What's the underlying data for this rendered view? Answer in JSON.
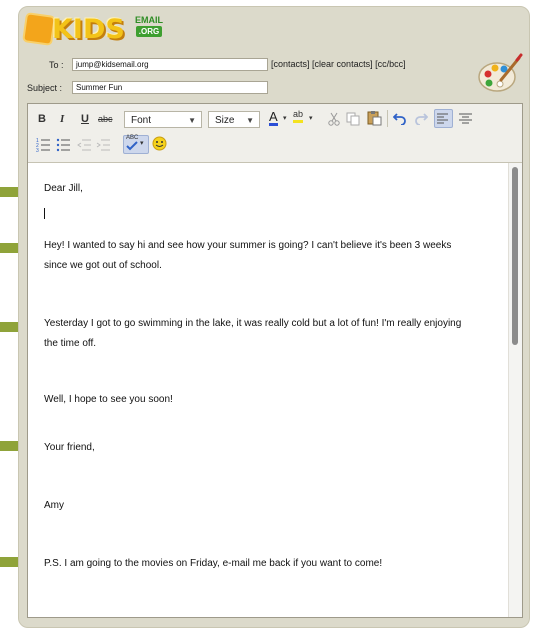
{
  "logo": {
    "main": "KIDS",
    "email": "EMAIL",
    "org": ".ORG"
  },
  "to": {
    "label": "To :",
    "value": "jump@kidsemail.org"
  },
  "links": {
    "contacts": "[contacts]",
    "clear": "[clear contacts]",
    "ccbcc": "[cc/bcc]"
  },
  "subject": {
    "label": "Subject :",
    "value": "Summer Fun"
  },
  "toolbar": {
    "bold": "B",
    "italic": "I",
    "underline": "U",
    "strike": "abc",
    "font": "Font",
    "size": "Size",
    "font_color": "A",
    "highlight": "ab",
    "spell": "ABC"
  },
  "message": {
    "greeting": "Dear Jill,",
    "p1_line1": "Hey! I wanted to say hi and see how your summer is going? I can't believe it's been 3 weeks",
    "p1_line2": "since we got out of school.",
    "p2_line1": "Yesterday I got to go swimming in the lake, it was really cold but a lot of fun! I'm really enjoying",
    "p2_line2": "the time off.",
    "closing1": "Well, I hope to see you soon!",
    "closing2": "Your friend,",
    "signature": "Amy",
    "ps": "P.S. I am going to the movies on Friday, e-mail me back if you want to come!"
  },
  "colors": {
    "frame": "#dcdacb",
    "arrow": "#8fa33a",
    "logo_yellow": "#f3c318",
    "logo_green": "#3e9f30"
  }
}
